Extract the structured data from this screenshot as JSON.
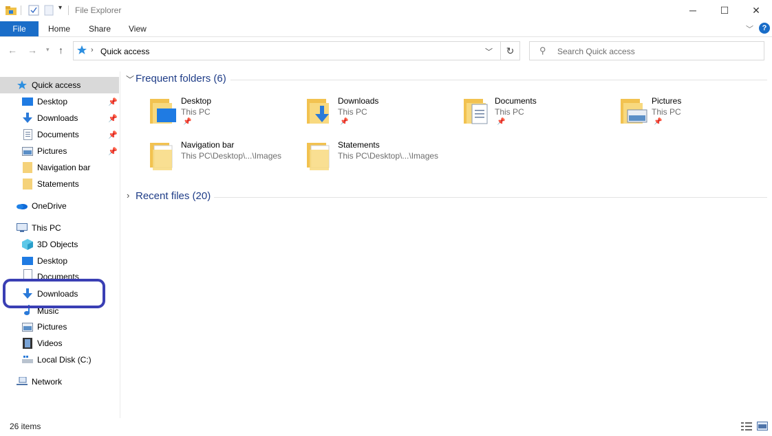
{
  "window": {
    "title": "File Explorer"
  },
  "ribbon": {
    "tabs": [
      "File",
      "Home",
      "Share",
      "View"
    ]
  },
  "address": {
    "path": "Quick access",
    "search_placeholder": "Search Quick access"
  },
  "nav_pane": {
    "quick_access": "Quick access",
    "qa_items": [
      {
        "label": "Desktop",
        "icon": "desktop-icon",
        "pinned": true
      },
      {
        "label": "Downloads",
        "icon": "downloads-icon",
        "pinned": true
      },
      {
        "label": "Documents",
        "icon": "documents-icon",
        "pinned": true
      },
      {
        "label": "Pictures",
        "icon": "pictures-icon",
        "pinned": true
      },
      {
        "label": "Navigation bar",
        "icon": "folder-icon",
        "pinned": false
      },
      {
        "label": "Statements",
        "icon": "folder-icon",
        "pinned": false
      }
    ],
    "onedrive": "OneDrive",
    "this_pc": "This PC",
    "pc_items": [
      {
        "label": "3D Objects",
        "icon": "3d-objects-icon"
      },
      {
        "label": "Desktop",
        "icon": "desktop-icon"
      },
      {
        "label": "Documents",
        "icon": "documents-icon"
      },
      {
        "label": "Downloads",
        "icon": "downloads-icon"
      },
      {
        "label": "Music",
        "icon": "music-icon"
      },
      {
        "label": "Pictures",
        "icon": "pictures-icon"
      },
      {
        "label": "Videos",
        "icon": "videos-icon"
      },
      {
        "label": "Local Disk (C:)",
        "icon": "local-disk-icon"
      }
    ],
    "network": "Network"
  },
  "content": {
    "frequent_header": "Frequent folders (6)",
    "recent_header": "Recent files (20)",
    "folders": [
      {
        "name": "Desktop",
        "location": "This PC",
        "pinned": true,
        "icon": "desktop-folder-icon"
      },
      {
        "name": "Downloads",
        "location": "This PC",
        "pinned": true,
        "icon": "downloads-folder-icon"
      },
      {
        "name": "Documents",
        "location": "This PC",
        "pinned": true,
        "icon": "documents-folder-icon"
      },
      {
        "name": "Pictures",
        "location": "This PC",
        "pinned": true,
        "icon": "pictures-folder-icon"
      },
      {
        "name": "Navigation bar",
        "location": "This PC\\Desktop\\...\\Images",
        "pinned": false,
        "icon": "folder-icon"
      },
      {
        "name": "Statements",
        "location": "This PC\\Desktop\\...\\Images",
        "pinned": false,
        "icon": "folder-icon"
      }
    ]
  },
  "status": {
    "items_count": "26 items"
  },
  "colors": {
    "accent": "#1a6dc8",
    "highlight": "#3a3fb4",
    "section_header": "#1e3c87"
  }
}
